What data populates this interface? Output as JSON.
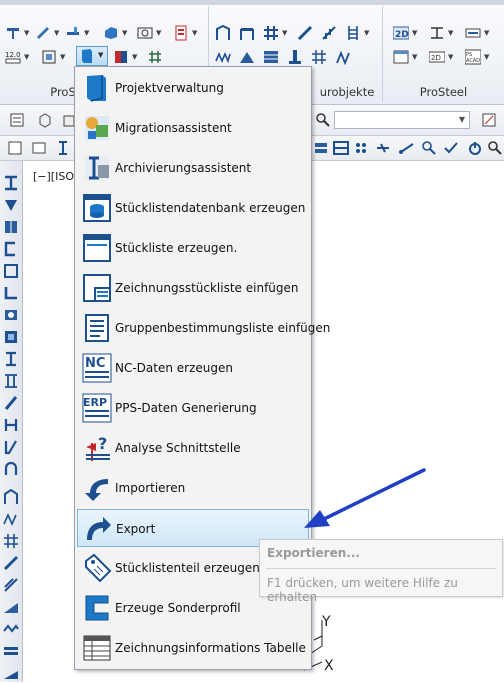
{
  "ribbon": {
    "groups": [
      {
        "label": "ProS"
      },
      {
        "label": "urobjekte"
      },
      {
        "label": "ProSteel Detaillierung"
      }
    ]
  },
  "viewport": {
    "label": "[−][ISO..."
  },
  "menu": {
    "items": [
      {
        "label": "Projektverwaltung",
        "icon": "book-icon"
      },
      {
        "label": "Migrationsassistent",
        "icon": "migration-icon"
      },
      {
        "label": "Archivierungsassistent",
        "icon": "archive-icon"
      },
      {
        "label": "Stücklistendatenbank erzeugen",
        "icon": "database-icon"
      },
      {
        "label": "Stückliste erzeugen.",
        "icon": "list-window-icon"
      },
      {
        "label": "Zeichnungsstückliste einfügen",
        "icon": "drawing-list-icon"
      },
      {
        "label": "Gruppenbestimmungsliste einfügen",
        "icon": "group-list-icon"
      },
      {
        "label": "NC-Daten erzeugen",
        "icon": "nc-icon"
      },
      {
        "label": "PPS-Daten Generierung",
        "icon": "erp-icon"
      },
      {
        "label": "Analyse Schnittstelle",
        "icon": "analysis-icon"
      },
      {
        "label": "Importieren",
        "icon": "import-arrow-icon"
      },
      {
        "label": "Export",
        "icon": "export-arrow-icon"
      },
      {
        "label": "Stücklistenteil erzeugen.",
        "icon": "tag-icon"
      },
      {
        "label": "Erzeuge Sonderprofil",
        "icon": "special-profile-icon"
      },
      {
        "label": "Zeichnungsinformations Tabelle",
        "icon": "info-table-icon"
      }
    ],
    "highlighted_index": 11
  },
  "tooltip": {
    "title": "Exportieren...",
    "help": "F1 drücken, um weitere Hilfe zu erhalten"
  },
  "axes": {
    "y": "Y",
    "x": "X"
  },
  "colors": {
    "highlight": "#cfe6f7",
    "arrow": "#1f3fc4",
    "icon_blue": "#1e78c8"
  }
}
